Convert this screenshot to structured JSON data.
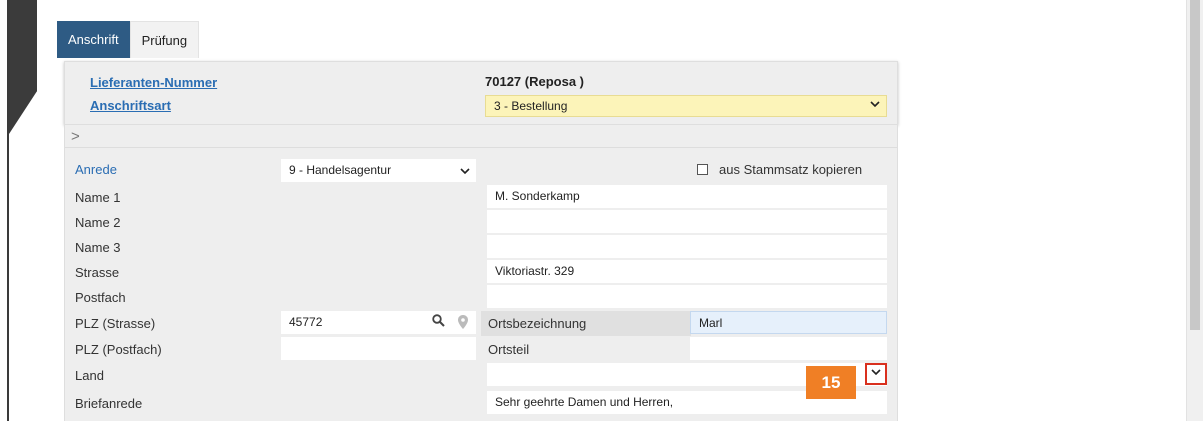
{
  "tabs": [
    {
      "label": "Anschrift",
      "active": true
    },
    {
      "label": "Prüfung",
      "active": false
    }
  ],
  "header": {
    "supplier_label": "Lieferanten-Nummer",
    "supplier_value": "70127 (Reposa )",
    "address_type_label": "Anschriftsart",
    "address_type_value": "3 - Bestellung"
  },
  "expander": ">",
  "form": {
    "anrede_label": "Anrede",
    "anrede_value": "9 - Handelsagentur",
    "copy_checkbox_label": "aus Stammsatz kopieren",
    "name1_label": "Name 1",
    "name1_value": "M. Sonderkamp",
    "name2_label": "Name 2",
    "name2_value": "",
    "name3_label": "Name 3",
    "name3_value": "",
    "strasse_label": "Strasse",
    "strasse_value": "Viktoriastr. 329",
    "postfach_label": "Postfach",
    "postfach_value": "",
    "plz_strasse_label": "PLZ (Strasse)",
    "plz_strasse_value": "45772",
    "ortsbezeichnung_label": "Ortsbezeichnung",
    "ortsbezeichnung_value": "Marl",
    "plz_postfach_label": "PLZ (Postfach)",
    "plz_postfach_value": "",
    "ortsteil_label": "Ortsteil",
    "ortsteil_value": "",
    "land_label": "Land",
    "land_value": "",
    "briefanrede_label": "Briefanrede",
    "briefanrede_value": "Sehr geehrte Damen und Herren,"
  },
  "step_badge": "15",
  "icons": {
    "chevron": "⌄",
    "search": "search-icon",
    "pin": "map-pin-icon"
  },
  "colors": {
    "tab_active": "#2e5b84",
    "link": "#2a6db3",
    "highlight_select": "#fcf4b9",
    "badge": "#f07f25",
    "callout_border": "#d9301e"
  }
}
